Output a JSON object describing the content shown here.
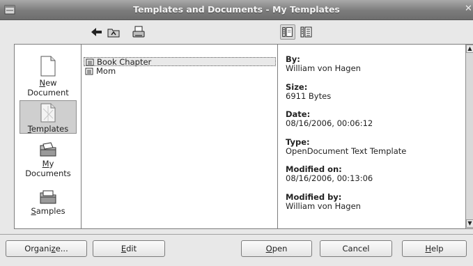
{
  "window": {
    "title": "Templates and Documents - My Templates"
  },
  "sidebar": {
    "items": [
      {
        "label_pre": "",
        "label_mnemonic": "N",
        "label_post": "ew",
        "label_line2": "Document"
      },
      {
        "label_pre": "",
        "label_mnemonic": "T",
        "label_post": "emplates",
        "label_line2": ""
      },
      {
        "label_pre": "",
        "label_mnemonic": "M",
        "label_post": "y",
        "label_line2": "Documents"
      },
      {
        "label_pre": "",
        "label_mnemonic": "S",
        "label_post": "amples",
        "label_line2": ""
      }
    ]
  },
  "files": [
    {
      "name": "Book Chapter"
    },
    {
      "name": "Mom"
    }
  ],
  "info": {
    "by_label": "By:",
    "by_value": "William von Hagen",
    "size_label": "Size:",
    "size_value": "6911 Bytes",
    "date_label": "Date:",
    "date_value": "08/16/2006, 00:06:12",
    "type_label": "Type:",
    "type_value": "OpenDocument Text Template",
    "modified_on_label": "Modified on:",
    "modified_on_value": "08/16/2006, 00:13:06",
    "modified_by_label": "Modified by:",
    "modified_by_value": "William von Hagen"
  },
  "buttons": {
    "organize_pre": "Organi",
    "organize_mn": "z",
    "organize_post": "e...",
    "edit_mn": "E",
    "edit_post": "dit",
    "open_mn": "O",
    "open_post": "pen",
    "cancel": "Cancel",
    "help_mn": "H",
    "help_post": "elp"
  }
}
